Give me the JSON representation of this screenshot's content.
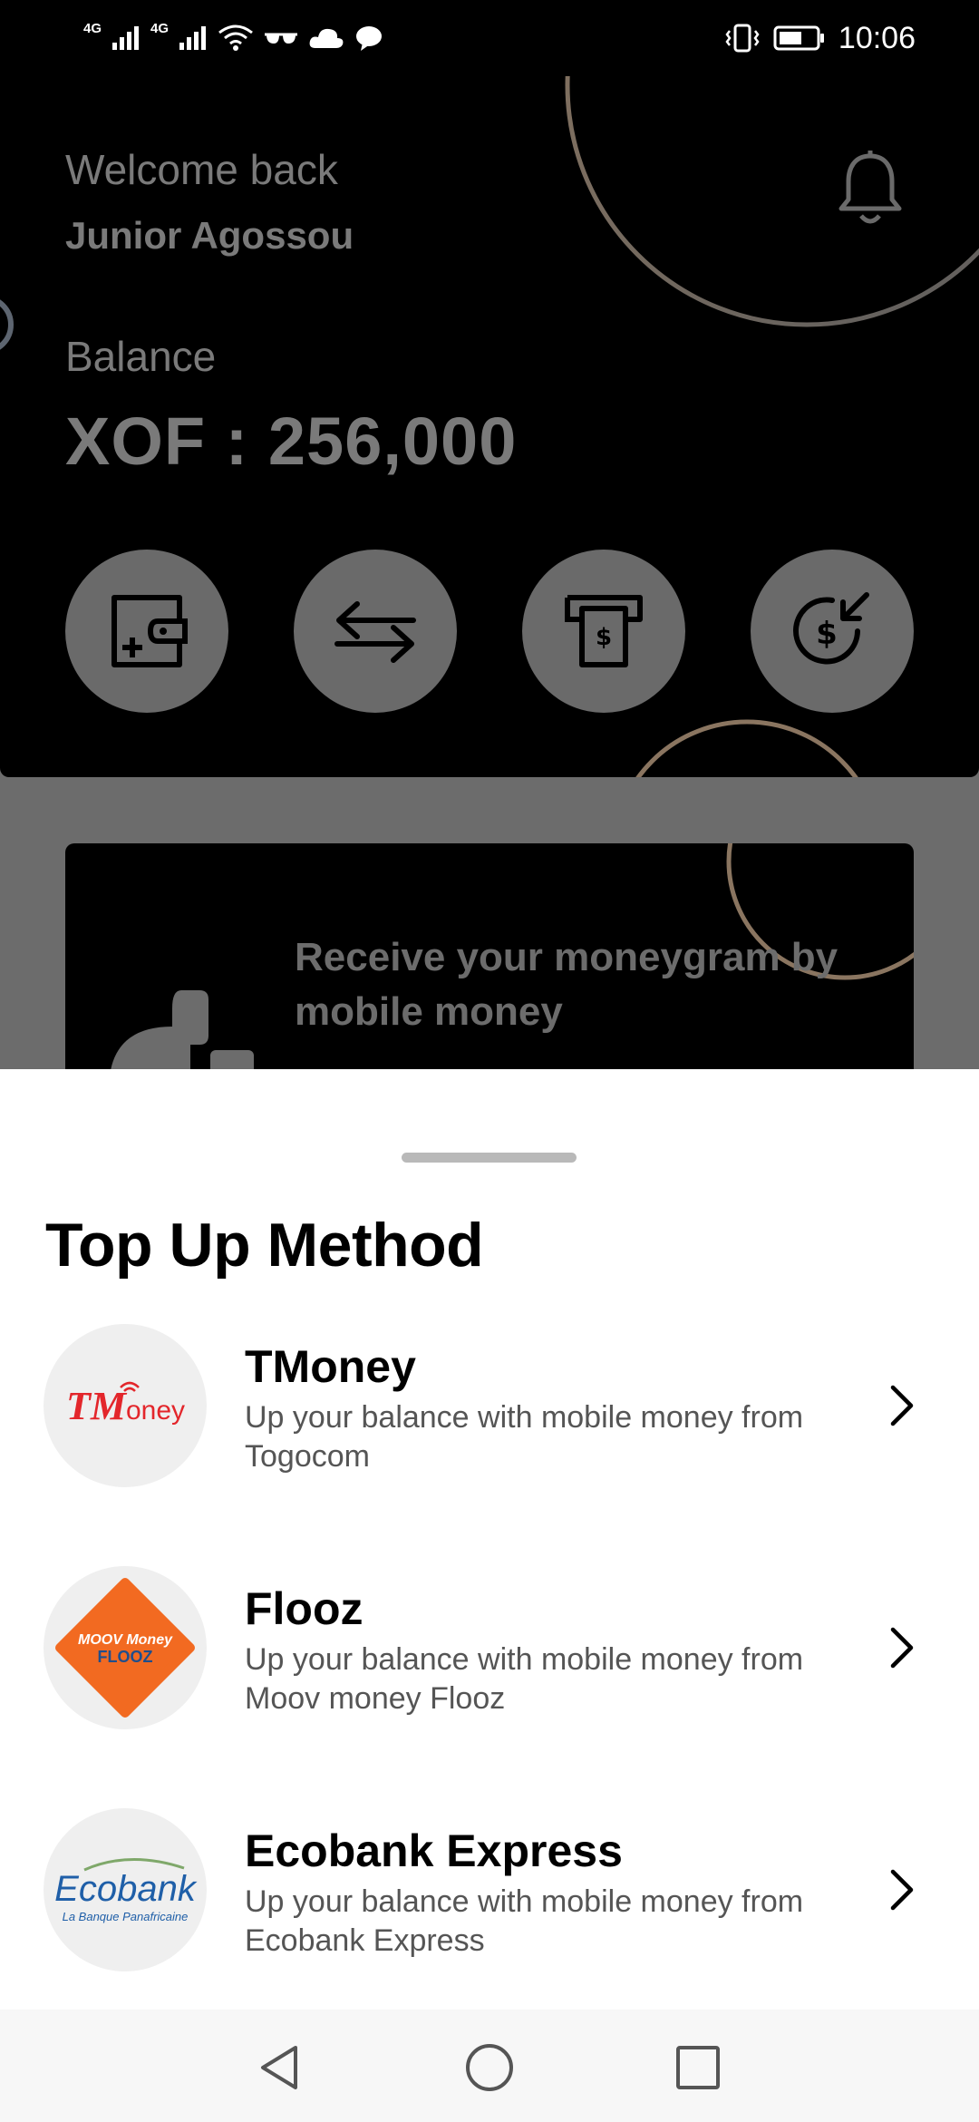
{
  "status_bar": {
    "signal_1_label": "4G",
    "signal_2_label": "4G",
    "time": "10:06",
    "icons": [
      "signal-icon",
      "wifi-icon",
      "glasses-icon",
      "cloud-icon",
      "chat-icon",
      "vibrate-icon",
      "battery-icon"
    ]
  },
  "home": {
    "welcome": "Welcome back",
    "user_name": "Junior Agossou",
    "balance_label": "Balance",
    "balance_value": "XOF : 256,000",
    "actions": [
      {
        "icon": "wallet-add-icon"
      },
      {
        "icon": "transfer-icon"
      },
      {
        "icon": "atm-withdraw-icon"
      },
      {
        "icon": "receive-money-icon"
      }
    ],
    "promo_text": "Receive your moneygram by mobile money"
  },
  "sheet": {
    "title": "Top Up Method",
    "methods": [
      {
        "name": "TMoney",
        "description": "Up your balance with mobile money from Togocom",
        "logo_text": "TMoney",
        "logo_color": "#e3262b"
      },
      {
        "name": "Flooz",
        "description": "Up your balance with mobile money from Moov money Flooz",
        "logo_text_top": "MOOV Money",
        "logo_text_bottom": "FLOOZ",
        "logo_color": "#f26a21"
      },
      {
        "name": "Ecobank Express",
        "description": "Up your balance with mobile money from Ecobank Express",
        "logo_text": "Ecobank",
        "logo_tagline": "La Banque Panafricaine",
        "logo_color": "#1f5fa8"
      }
    ]
  },
  "colors": {
    "hero_bg": "#000000",
    "dim_overlay": "#6c6c6c",
    "accent_ring": "#8a7560",
    "text_muted": "#7a7a7a"
  }
}
